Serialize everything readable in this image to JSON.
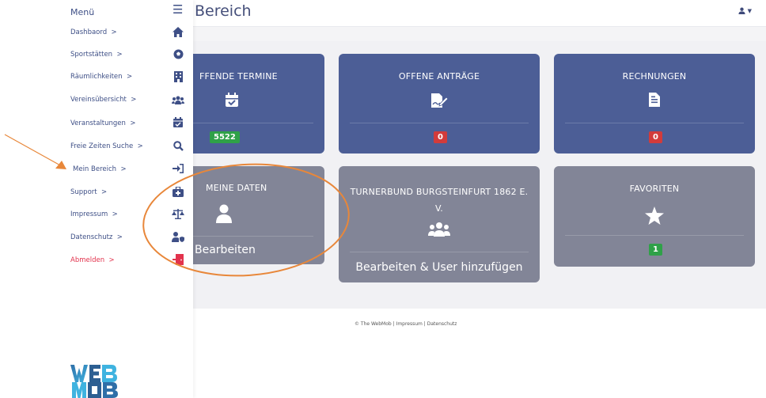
{
  "header": {
    "title": "Bereich"
  },
  "sidebar": {
    "heading": "Menü",
    "items": [
      {
        "label": "Dashbaord",
        "icon": "home-icon"
      },
      {
        "label": "Sportstätten",
        "icon": "soccer-ball-icon"
      },
      {
        "label": "Räumlichkeiten",
        "icon": "building-icon"
      },
      {
        "label": "Vereinsübersicht",
        "icon": "users-icon"
      },
      {
        "label": "Veranstaltungen",
        "icon": "calendar-icon"
      },
      {
        "label": "Freie Zeiten Suche",
        "icon": "search-icon"
      },
      {
        "label": "Mein Bereich",
        "icon": "sign-in-icon"
      },
      {
        "label": "Support",
        "icon": "first-aid-icon"
      },
      {
        "label": "Impressum",
        "icon": "scale-icon"
      },
      {
        "label": "Datenschutz",
        "icon": "user-shield-icon"
      },
      {
        "label": "Abmelden",
        "icon": "door-exit-icon"
      }
    ],
    "chevron": ">"
  },
  "cards": {
    "termine": {
      "title": "FFENDE TERMINE",
      "badge": "5522"
    },
    "antraege": {
      "title": "OFFENE ANTRÄGE",
      "badge": "0"
    },
    "rechnungen": {
      "title": "RECHNUNGEN",
      "badge": "0"
    },
    "daten": {
      "title": "MEINE DATEN",
      "action": "Bearbeiten"
    },
    "verein": {
      "title_line1": "TURNERBUND BURGSTEINFURT 1862 E.",
      "title_line2": "V.",
      "action": "Bearbeiten & User hinzufügen"
    },
    "favoriten": {
      "title": "FAVORITEN",
      "badge": "1"
    }
  },
  "footer": {
    "text": "© The WebMob | Impressum | Datenschutz"
  },
  "colors": {
    "accent": "#4c5e96",
    "grey_card": "#828597",
    "logout": "#e2334d",
    "annotation": "#e8873a"
  }
}
